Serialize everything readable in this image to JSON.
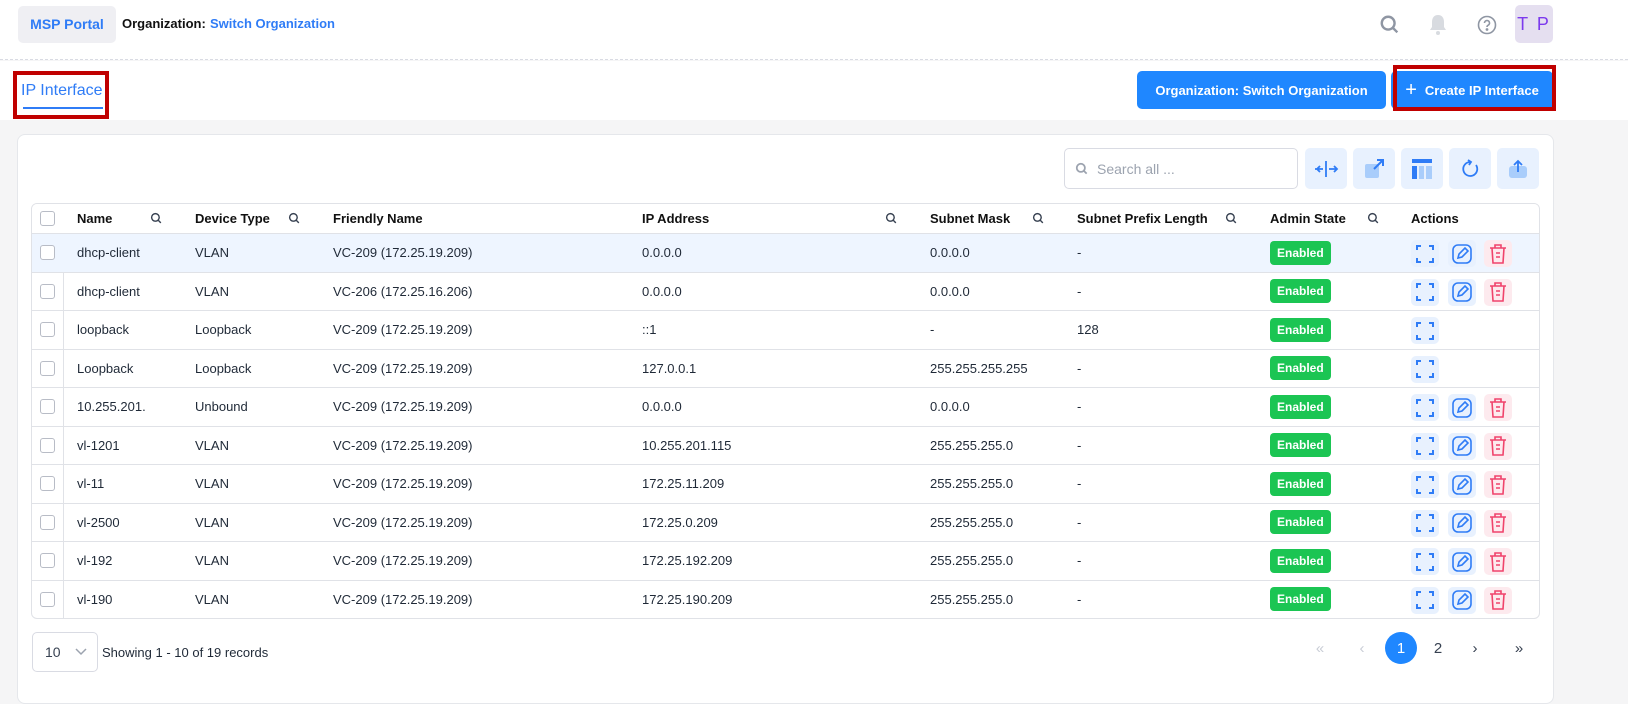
{
  "topbar": {
    "portal": "MSP Portal",
    "org_label": "Organization:",
    "org_link": "Switch Organization",
    "avatar": "T P"
  },
  "page": {
    "tab": "IP Interface",
    "org_button": "Organization: Switch Organization",
    "create_button": "Create IP Interface"
  },
  "search": {
    "placeholder": "Search all ..."
  },
  "table": {
    "columns": [
      "Name",
      "Device Type",
      "Friendly Name",
      "IP Address",
      "Subnet Mask",
      "Subnet Prefix Length",
      "Admin State",
      "Actions"
    ],
    "rows": [
      {
        "name": "dhcp-client",
        "type": "VLAN",
        "friendly": "VC-209 (172.25.19.209)",
        "ip": "0.0.0.0",
        "mask": "0.0.0.0",
        "prefix": "-",
        "state": "Enabled",
        "actions": [
          "view",
          "edit",
          "delete"
        ]
      },
      {
        "name": "dhcp-client",
        "type": "VLAN",
        "friendly": "VC-206 (172.25.16.206)",
        "ip": "0.0.0.0",
        "mask": "0.0.0.0",
        "prefix": "-",
        "state": "Enabled",
        "actions": [
          "view",
          "edit",
          "delete"
        ]
      },
      {
        "name": "loopback",
        "type": "Loopback",
        "friendly": "VC-209 (172.25.19.209)",
        "ip": "::1",
        "mask": "-",
        "prefix": "128",
        "state": "Enabled",
        "actions": [
          "view"
        ]
      },
      {
        "name": "Loopback",
        "type": "Loopback",
        "friendly": "VC-209 (172.25.19.209)",
        "ip": "127.0.0.1",
        "mask": "255.255.255.255",
        "prefix": "-",
        "state": "Enabled",
        "actions": [
          "view"
        ]
      },
      {
        "name": "10.255.201.",
        "type": "Unbound",
        "friendly": "VC-209 (172.25.19.209)",
        "ip": "0.0.0.0",
        "mask": "0.0.0.0",
        "prefix": "-",
        "state": "Enabled",
        "actions": [
          "view",
          "edit",
          "delete"
        ]
      },
      {
        "name": "vl-1201",
        "type": "VLAN",
        "friendly": "VC-209 (172.25.19.209)",
        "ip": "10.255.201.115",
        "mask": "255.255.255.0",
        "prefix": "-",
        "state": "Enabled",
        "actions": [
          "view",
          "edit",
          "delete"
        ]
      },
      {
        "name": "vl-11",
        "type": "VLAN",
        "friendly": "VC-209 (172.25.19.209)",
        "ip": "172.25.11.209",
        "mask": "255.255.255.0",
        "prefix": "-",
        "state": "Enabled",
        "actions": [
          "view",
          "edit",
          "delete"
        ]
      },
      {
        "name": "vl-2500",
        "type": "VLAN",
        "friendly": "VC-209 (172.25.19.209)",
        "ip": "172.25.0.209",
        "mask": "255.255.255.0",
        "prefix": "-",
        "state": "Enabled",
        "actions": [
          "view",
          "edit",
          "delete"
        ]
      },
      {
        "name": "vl-192",
        "type": "VLAN",
        "friendly": "VC-209 (172.25.19.209)",
        "ip": "172.25.192.209",
        "mask": "255.255.255.0",
        "prefix": "-",
        "state": "Enabled",
        "actions": [
          "view",
          "edit",
          "delete"
        ]
      },
      {
        "name": "vl-190",
        "type": "VLAN",
        "friendly": "VC-209 (172.25.19.209)",
        "ip": "172.25.190.209",
        "mask": "255.255.255.0",
        "prefix": "-",
        "state": "Enabled",
        "actions": [
          "view",
          "edit",
          "delete"
        ]
      }
    ]
  },
  "pagination": {
    "page_size": "10",
    "showing": "Showing 1 - 10 of 19 records",
    "pages": [
      "1",
      "2"
    ],
    "current": "1"
  },
  "colors": {
    "accent": "#1f87ff",
    "enabled": "#1bc553",
    "delete": "#f0436b"
  }
}
